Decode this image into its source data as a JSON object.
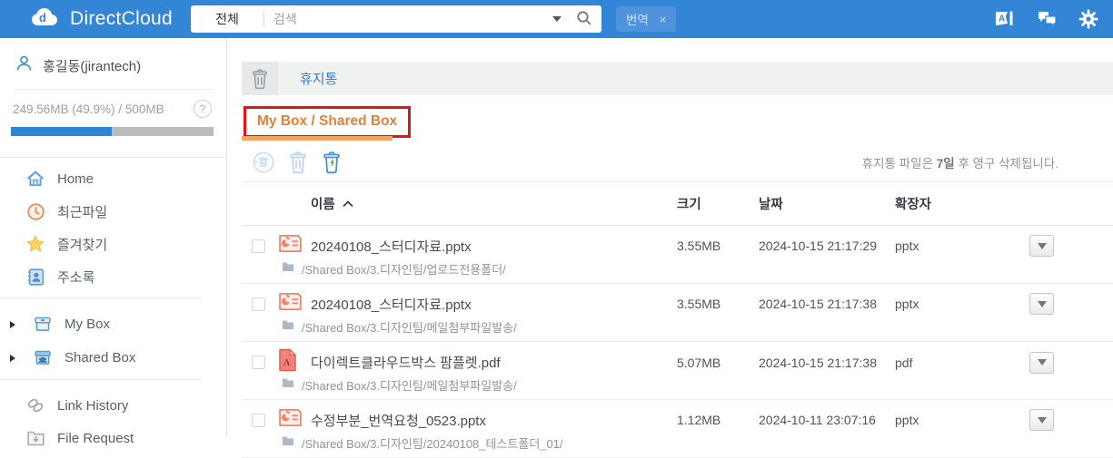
{
  "colors": {
    "header_blue": "#3385d6",
    "accent_blue": "#4a90d9",
    "link_blue": "#3c7dc8",
    "tab_orange": "#e0813d",
    "tab_underline_orange": "#f4a55c",
    "annotation_red": "#e31414",
    "progress_blue": "#2e86d3",
    "progress_track_gray": "#b9bcbf",
    "bolt_green": "#3cb54a"
  },
  "header": {
    "logo_text": "DirectCloud",
    "search": {
      "scope": "전체",
      "placeholder": "검색"
    },
    "tag": {
      "label": "번역",
      "close": "×"
    },
    "icons": [
      "translate-icon",
      "chat-icon",
      "settings-icon"
    ]
  },
  "sidebar": {
    "user": {
      "name": "홍길동(jirantech)"
    },
    "storage": {
      "text": "249.56MB (49.9%) / 500MB",
      "percent": 49.9,
      "help": "?"
    },
    "nav_top": [
      {
        "label": "Home",
        "icon": "home-icon"
      },
      {
        "label": "최근파일",
        "icon": "clock-icon"
      },
      {
        "label": "즐겨찾기",
        "icon": "star-icon"
      },
      {
        "label": "주소록",
        "icon": "address-book-icon"
      }
    ],
    "nav_boxes": [
      {
        "label": "My Box",
        "icon": "my-box-icon"
      },
      {
        "label": "Shared Box",
        "icon": "shared-box-icon"
      }
    ],
    "nav_bottom": [
      {
        "label": "Link History",
        "icon": "link-icon"
      },
      {
        "label": "File Request",
        "icon": "file-request-icon"
      }
    ]
  },
  "main": {
    "breadcrumb": {
      "title": "휴지통"
    },
    "tab": {
      "label": "My Box / Shared Box"
    },
    "toolbar_icons": [
      "restore-icon",
      "delete-icon",
      "empty-trash-icon"
    ],
    "notice": {
      "prefix": "휴지통 파일은 ",
      "bold": "7일",
      "suffix": " 후 영구 삭제됩니다."
    },
    "table": {
      "columns": {
        "name": "이름",
        "size": "크기",
        "date": "날짜",
        "ext": "확장자"
      },
      "sort_column": "이름",
      "sort_direction": "asc",
      "rows": [
        {
          "name": "20240108_스터디자료.pptx",
          "type": "pptx",
          "path": "/Shared Box/3.디자인팀/업로드전용폴더/",
          "size": "3.55MB",
          "date": "2024-10-15 21:17:29",
          "ext": "pptx"
        },
        {
          "name": "20240108_스터디자료.pptx",
          "type": "pptx",
          "path": "/Shared Box/3.디자인팀/메일첨부파일발송/",
          "size": "3.55MB",
          "date": "2024-10-15 21:17:38",
          "ext": "pptx"
        },
        {
          "name": "다이렉트클라우드박스 팜플렛.pdf",
          "type": "pdf",
          "path": "/Shared Box/3.디자인팀/메일첨부파일발송/",
          "size": "5.07MB",
          "date": "2024-10-15 21:17:38",
          "ext": "pdf"
        },
        {
          "name": "수정부분_번역요청_0523.pptx",
          "type": "pptx",
          "path": "/Shared Box/3.디자인팀/20240108_테스트폴더_01/",
          "size": "1.12MB",
          "date": "2024-10-11 23:07:16",
          "ext": "pptx"
        }
      ]
    }
  }
}
